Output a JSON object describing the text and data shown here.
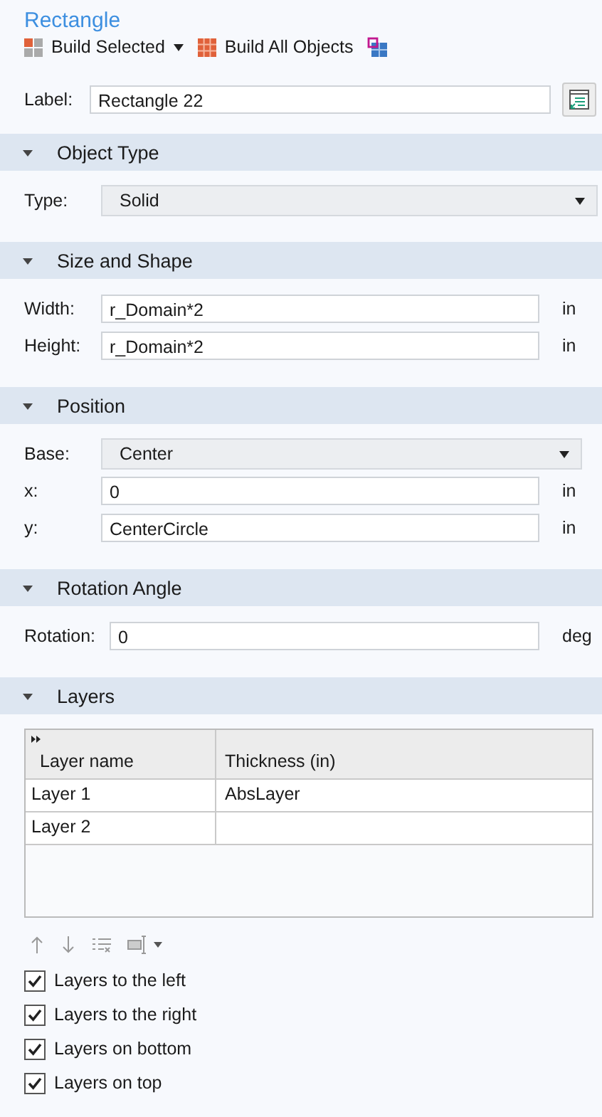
{
  "title": "Rectangle",
  "toolbar": [
    {
      "label": "Build Selected",
      "dropdown": true
    },
    {
      "label": "Build All Objects",
      "dropdown": false
    }
  ],
  "label_field": {
    "label": "Label:",
    "value": "Rectangle 22"
  },
  "sections": [
    {
      "title": "Object Type",
      "expanded": true,
      "kind": "fields",
      "fields": [
        {
          "kind": "select",
          "label": "Type:",
          "value": "Solid"
        }
      ]
    },
    {
      "title": "Size and Shape",
      "expanded": true,
      "kind": "fields",
      "fields": [
        {
          "kind": "input",
          "label": "Width:",
          "value": "r_Domain*2",
          "unit": "in"
        },
        {
          "kind": "input",
          "label": "Height:",
          "value": "r_Domain*2",
          "unit": "in"
        }
      ]
    },
    {
      "title": "Position",
      "expanded": true,
      "kind": "fields",
      "fields": [
        {
          "kind": "select-narrow",
          "label": "Base:",
          "value": "Center"
        },
        {
          "kind": "input",
          "label": "x:",
          "value": "0",
          "unit": "in"
        },
        {
          "kind": "input",
          "label": "y:",
          "value": "CenterCircle",
          "unit": "in"
        }
      ]
    },
    {
      "title": "Rotation Angle",
      "expanded": true,
      "kind": "fields",
      "fields": [
        {
          "kind": "input",
          "label": "Rotation:",
          "value": "0",
          "unit": "deg"
        }
      ]
    },
    {
      "title": "Layers",
      "expanded": true,
      "kind": "layers",
      "columns": [
        "Layer name",
        "Thickness (in)"
      ],
      "rows": [
        {
          "name": "Layer 1",
          "thickness": "AbsLayer"
        },
        {
          "name": "Layer 2"
        }
      ],
      "checkboxes": [
        {
          "label": "Layers to the left",
          "checked": true
        },
        {
          "label": "Layers to the right",
          "checked": true
        },
        {
          "label": "Layers on bottom",
          "checked": true
        },
        {
          "label": "Layers on top",
          "checked": true
        }
      ]
    }
  ]
}
